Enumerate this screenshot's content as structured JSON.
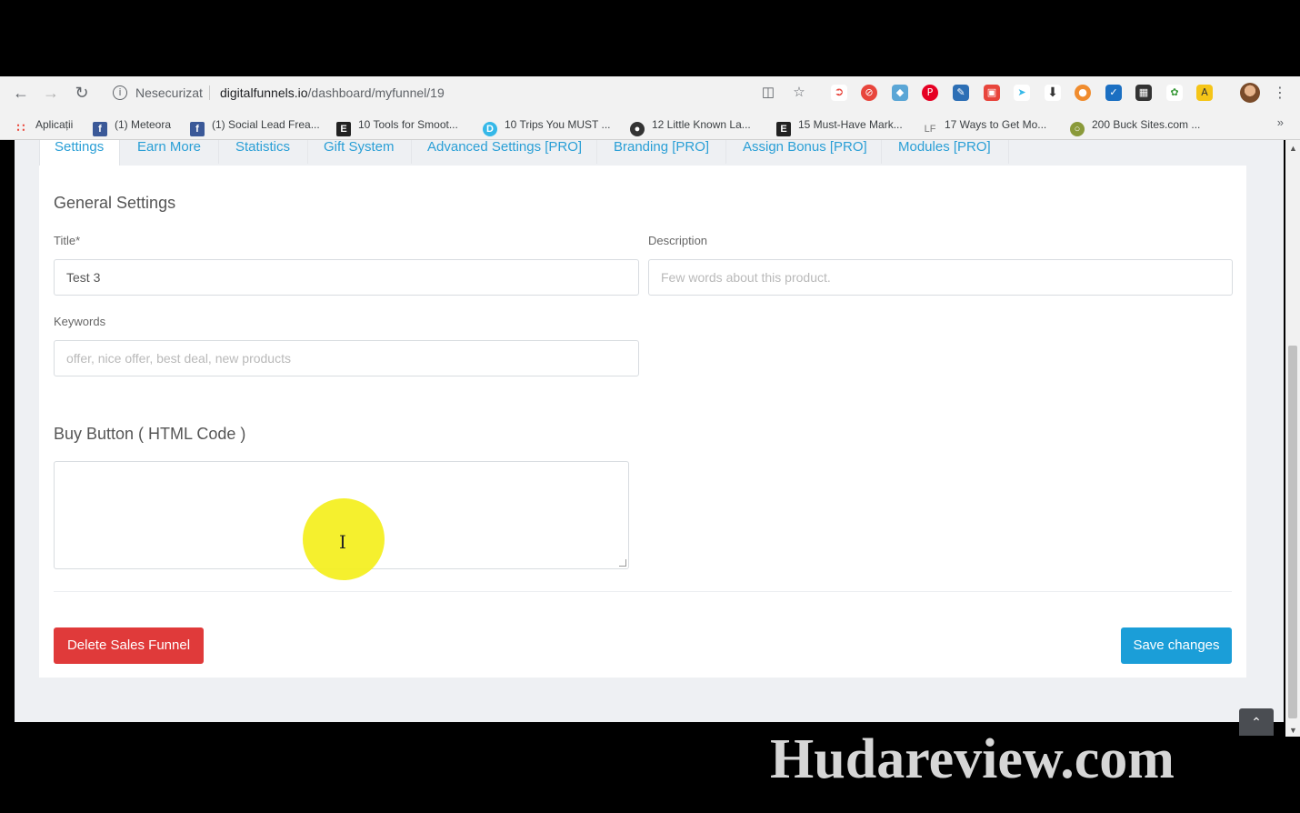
{
  "browser": {
    "security_label": "Nesecurizat",
    "url_host": "digitalfunnels.io",
    "url_path": "/dashboard/myfunnel/19"
  },
  "bookmarks": [
    {
      "label": "Aplicații",
      "icon": "apps-grid-icon",
      "color": "#e94235"
    },
    {
      "label": "(1) Meteora",
      "icon": "facebook-icon",
      "color": "#3b5998"
    },
    {
      "label": "(1) Social Lead Frea...",
      "icon": "facebook-icon",
      "color": "#3b5998"
    },
    {
      "label": "10 Tools for Smoot...",
      "icon": "e-letter-icon",
      "color": "#222222"
    },
    {
      "label": "10 Trips You MUST ...",
      "icon": "d-circle-icon",
      "color": "#35b8e8"
    },
    {
      "label": "12 Little Known La...",
      "icon": "dark-circle-icon",
      "color": "#333333"
    },
    {
      "label": "15 Must-Have Mark...",
      "icon": "e-letter-icon",
      "color": "#222222"
    },
    {
      "label": "17 Ways to Get Mo...",
      "icon": "lf-icon",
      "color": "#777777"
    },
    {
      "label": "200 Buck Sites.com ...",
      "icon": "globe-icon",
      "color": "#8a9a3a"
    }
  ],
  "tabs": [
    {
      "label": "Settings",
      "active": true
    },
    {
      "label": "Earn More"
    },
    {
      "label": "Statistics"
    },
    {
      "label": "Gift System"
    },
    {
      "label": "Advanced Settings [PRO]"
    },
    {
      "label": "Branding [PRO]"
    },
    {
      "label": "Assign Bonus [PRO]"
    },
    {
      "label": "Modules [PRO]"
    }
  ],
  "form": {
    "section_general": "General Settings",
    "title_label": "Title*",
    "title_value": "Test 3",
    "description_label": "Description",
    "description_placeholder": "Few words about this product.",
    "keywords_label": "Keywords",
    "keywords_placeholder": "offer, nice offer, best deal, new products",
    "section_buy_button": "Buy Button ( HTML Code )",
    "buy_button_value": ""
  },
  "actions": {
    "delete_label": "Delete Sales Funnel",
    "save_label": "Save changes"
  },
  "colors": {
    "accent": "#2a9fd6",
    "danger": "#e03a3a",
    "primary": "#1b9ed8"
  },
  "watermark": "Hudareview.com"
}
